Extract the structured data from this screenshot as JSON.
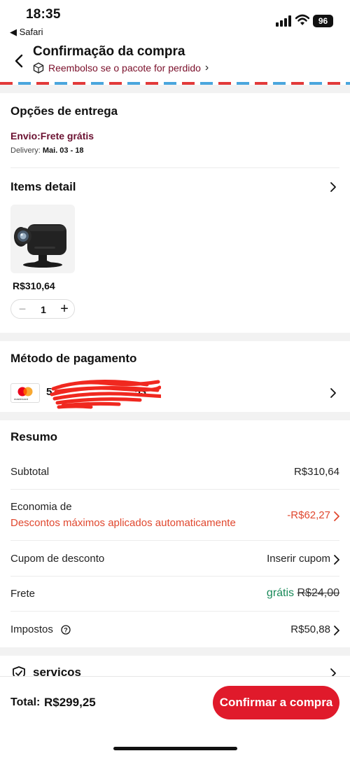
{
  "status_bar": {
    "time": "18:35",
    "back_app": "◀ Safari",
    "battery": "96"
  },
  "header": {
    "title": "Confirmação da compra",
    "subtitle": "Reembolso se o pacote for perdido",
    "subtitle_chevron": "›"
  },
  "delivery": {
    "title": "Opções de entrega",
    "shipping": "Envio:Frete grátis",
    "delivery_label": "Delivery:",
    "delivery_date": "Mai. 03 - 18"
  },
  "items": {
    "title": "Items detail",
    "price": "R$310,64",
    "quantity": "1",
    "minus": "−",
    "plus": "+"
  },
  "payment": {
    "title": "Método de pagamento",
    "card_brand_text": "mastercard",
    "card_number": "5",
    "card_number_end": "53"
  },
  "summary": {
    "title": "Resumo",
    "rows": [
      {
        "label": "Subtotal",
        "value": "R$310,64"
      },
      {
        "label": "Economia de",
        "sublabel": "Descontos máximos aplicados automaticamente",
        "value": "-R$62,27"
      },
      {
        "label": "Cupom de desconto",
        "value": "Inserir cupom"
      },
      {
        "label": "Frete",
        "value": "grátis",
        "old_value": "R$24,00"
      },
      {
        "label": "Impostos",
        "value": "R$50,88"
      }
    ]
  },
  "services": {
    "title": "serviços"
  },
  "footer": {
    "total_label": "Total:",
    "total_value": "R$299,25",
    "confirm_button": "Confirmar a compra"
  },
  "colors": {
    "accent": "#e01a2b",
    "discount": "#e0472e",
    "free": "#1a8a5a",
    "shipping_text": "#6a1030"
  }
}
